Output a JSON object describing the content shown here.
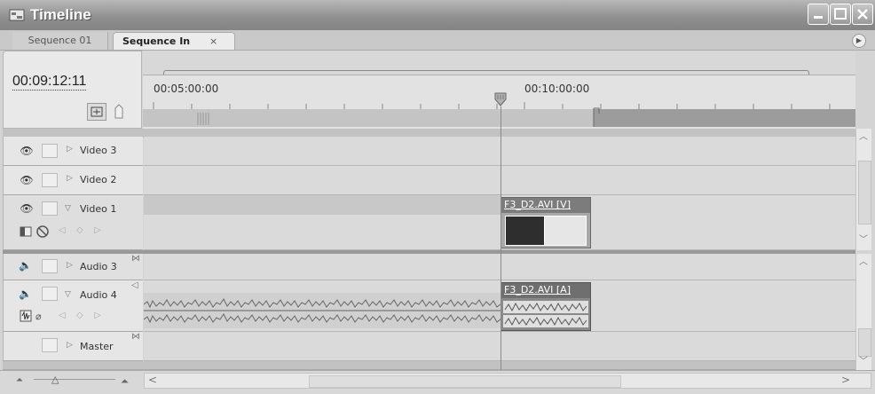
{
  "window": {
    "title": "Timeline"
  },
  "tabs": [
    {
      "label": "Sequence 01",
      "active": false
    },
    {
      "label": "Sequence In",
      "active": true
    }
  ],
  "timecode": "00:09:12:11",
  "ruler": {
    "labels": [
      "00:05:00:00",
      "00:10:00:00"
    ]
  },
  "tracks": {
    "video": [
      {
        "name": "Video 3"
      },
      {
        "name": "Video 2"
      },
      {
        "name": "Video 1"
      }
    ],
    "audio": [
      {
        "name": "Audio 3"
      },
      {
        "name": "Audio 4"
      },
      {
        "name": "Master"
      }
    ]
  },
  "clips": {
    "video_clip": "F3_D2.AVI [V]",
    "audio_clip": "F3_D2.AVI [A]"
  },
  "colors": {
    "titlebar": "#8e8e8e",
    "work_area_dark": "#a4a4a4",
    "playhead": "#8a8a8a"
  }
}
